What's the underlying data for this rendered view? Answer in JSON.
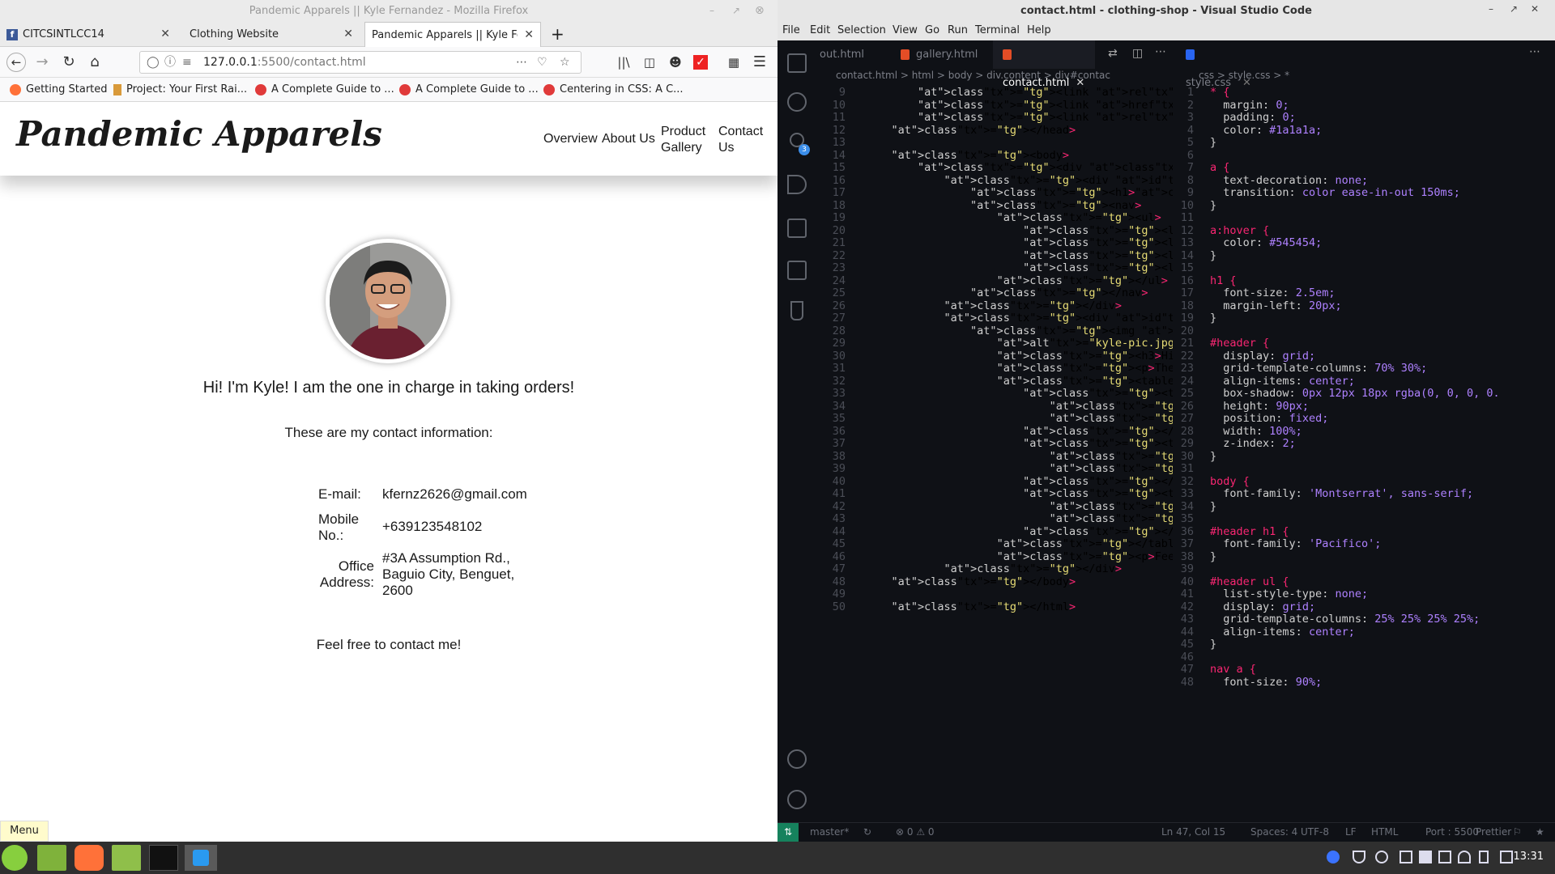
{
  "firefox": {
    "window_title": "Pandemic Apparels || Kyle Fernandez - Mozilla Firefox",
    "tabs": [
      {
        "label": "CITCSINTLCC14"
      },
      {
        "label": "Clothing Website"
      },
      {
        "label": "Pandemic Apparels || Kyle Ferna"
      }
    ],
    "url_host": "127.0.0.1",
    "url_rest": ":5500/contact.html",
    "bookmarks": [
      {
        "label": "Getting Started"
      },
      {
        "label": "Project: Your First Rai..."
      },
      {
        "label": "A Complete Guide to ..."
      },
      {
        "label": "A Complete Guide to ..."
      },
      {
        "label": "Centering in CSS: A C..."
      }
    ],
    "page": {
      "site_title": "Pandemic Apparels",
      "nav": [
        "Overview",
        "About Us",
        "Product Gallery",
        "Contact Us"
      ],
      "heading": "Hi! I'm Kyle! I am the one in charge in taking orders!",
      "intro": "These are my contact information:",
      "contacts": [
        {
          "label": "E-mail:",
          "value": "kfernz2626@gmail.com"
        },
        {
          "label": "Mobile No.:",
          "value": "+639123548102"
        },
        {
          "label": "Office Address:",
          "value": "#3A Assumption Rd., Baguio City, Benguet, 2600"
        }
      ],
      "footer_text": "Feel free to contact me!"
    },
    "menu_button": "Menu"
  },
  "vscode": {
    "window_title": "contact.html - clothing-shop - Visual Studio Code",
    "menu": [
      "File",
      "Edit",
      "Selection",
      "View",
      "Go",
      "Run",
      "Terminal",
      "Help"
    ],
    "tabs": [
      {
        "label": "out.html"
      },
      {
        "label": "gallery.html"
      },
      {
        "label": "contact.html"
      },
      {
        "label": "style.css"
      }
    ],
    "breadcrumb_left": "contact.html  >  html  >  body  >  div.content  >  div#contac",
    "breadcrumb_right": "css  >  style.css  >  *",
    "status": {
      "branch": "master*",
      "problems": "⊗ 0 ⚠ 0",
      "position": "Ln 47, Col 15",
      "spaces": "Spaces: 4",
      "encoding": "UTF-8",
      "eol": "LF",
      "language": "HTML",
      "port": "Port : 5500",
      "formatter": "Prettier"
    },
    "source_control_badge": "3"
  },
  "taskbar": {
    "clock": "13:31"
  }
}
